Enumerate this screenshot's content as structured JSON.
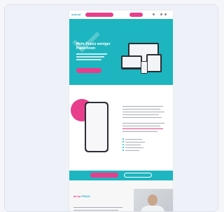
{
  "nav": {
    "logo": "sobraf",
    "pill_primary": "",
    "pill_secondary": "",
    "icons": [
      "search-icon",
      "user-icon",
      "menu-icon"
    ]
  },
  "hero": {
    "title": "Mehr Praxis weniger Papierkram",
    "button_label": "",
    "icons": [
      "check-icon"
    ]
  },
  "section_two": {
    "heading": "",
    "bullets": 5
  },
  "band": {
    "primary_label": "",
    "secondary_label": ""
  },
  "section_three": {
    "logo_prefix": "all by",
    "logo_brand": "PRAXI",
    "subheading": ""
  },
  "colors": {
    "teal": "#1db5bf",
    "pink": "#e83e8c",
    "dark": "#2b2f36",
    "background": "#eef1f8"
  }
}
